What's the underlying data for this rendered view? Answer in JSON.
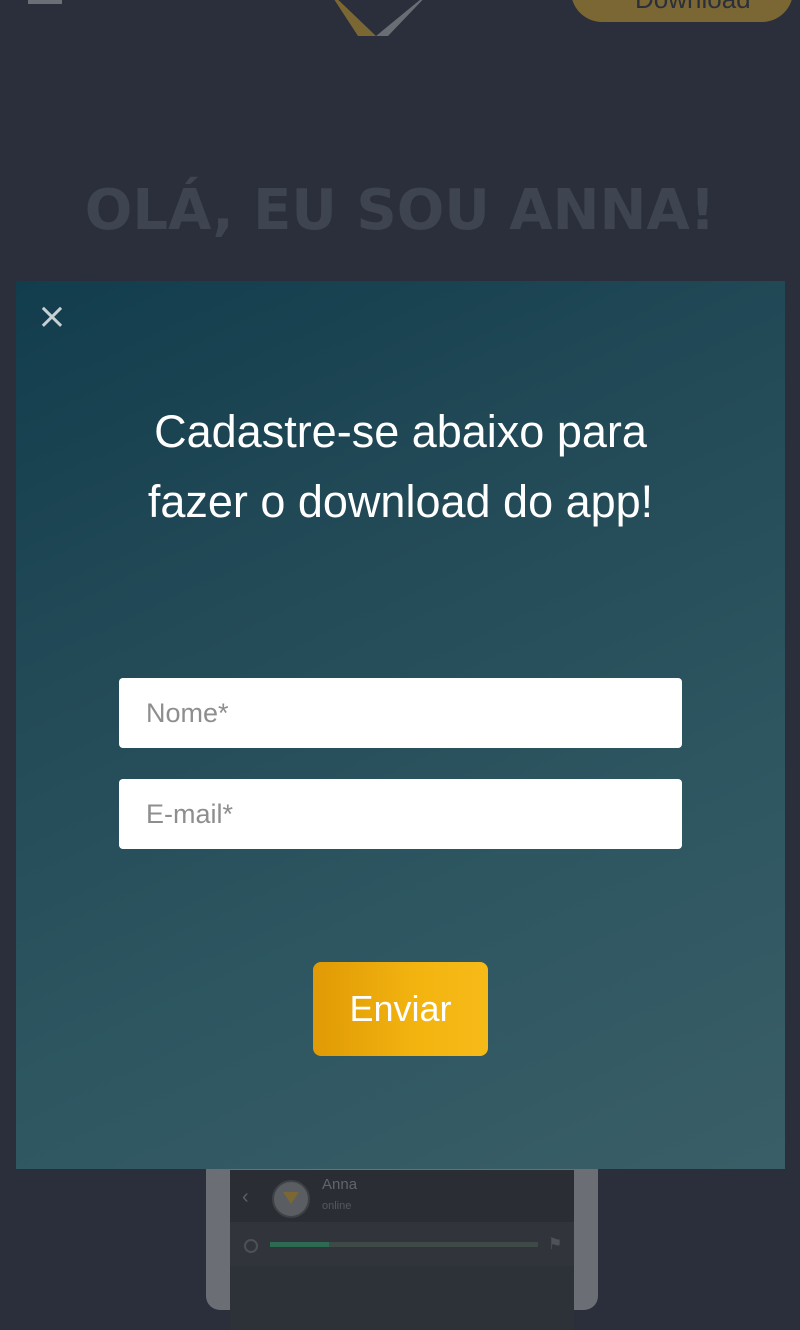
{
  "background": {
    "hero_title": "OLÁ, EU SOU ANNA!",
    "download_label": "Download",
    "chat_preview": {
      "contact_name": "Anna",
      "contact_status": "online",
      "progress": 0.22
    }
  },
  "modal": {
    "close_glyph": "×",
    "title_line1": "Cadastre-se abaixo para",
    "title_line2": "fazer o download do app!",
    "fields": {
      "name_placeholder": "Nome*",
      "email_placeholder": "E-mail*"
    },
    "submit_label": "Enviar"
  },
  "colors": {
    "accent": "#f3b410",
    "modal_bg_start": "#123d4d",
    "modal_bg_end": "#3a5e67",
    "page_bg": "#2a2f3b"
  },
  "icons": [
    "menu-icon",
    "brand-logo",
    "download-icon",
    "close-icon",
    "back-arrow-icon",
    "flag-icon"
  ]
}
